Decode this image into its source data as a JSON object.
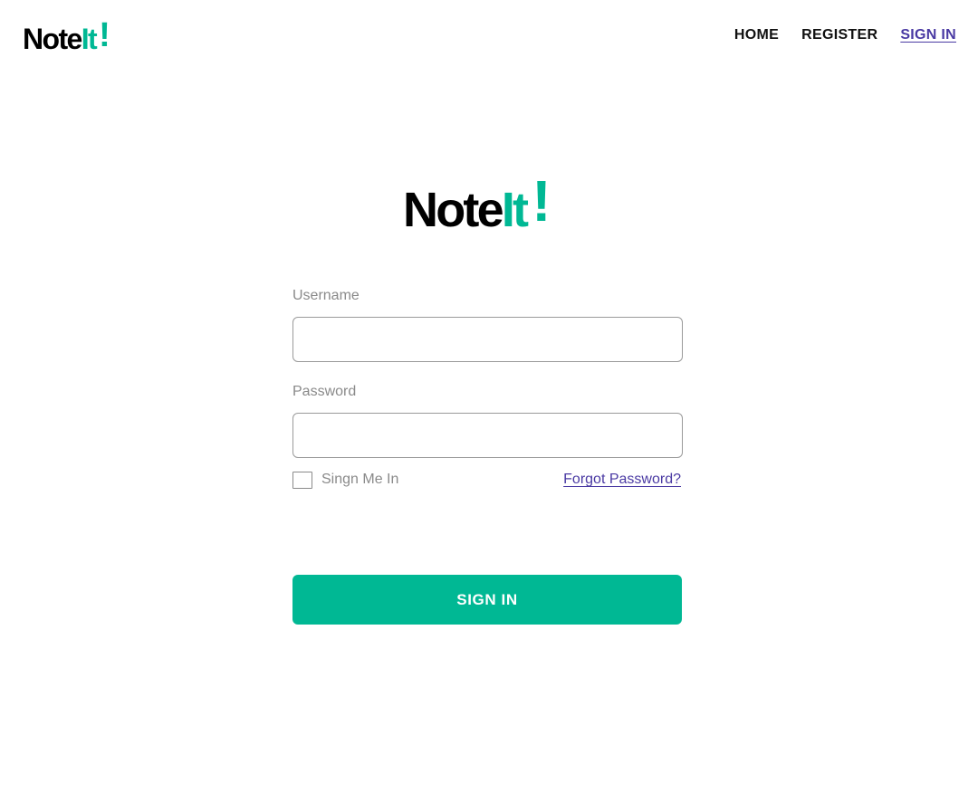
{
  "brand": {
    "name_part1": "Note",
    "name_part2": "It",
    "name_part3": "!",
    "primary_color": "#000000",
    "accent_color": "#00b894"
  },
  "nav": {
    "items": [
      {
        "label": "HOME",
        "active": false
      },
      {
        "label": "REGISTER",
        "active": false
      },
      {
        "label": "SIGN IN",
        "active": true
      }
    ],
    "active_color": "#4a3aa3"
  },
  "form": {
    "username": {
      "label": "Username",
      "value": "",
      "placeholder": ""
    },
    "password": {
      "label": "Password",
      "value": "",
      "placeholder": ""
    },
    "remember": {
      "label": "Singn Me In",
      "checked": false
    },
    "forgot_link": "Forgot Password?",
    "submit_label": "SIGN IN",
    "button_color": "#00b894"
  },
  "icons": {
    "checkbox": "checkbox-unchecked-icon"
  }
}
